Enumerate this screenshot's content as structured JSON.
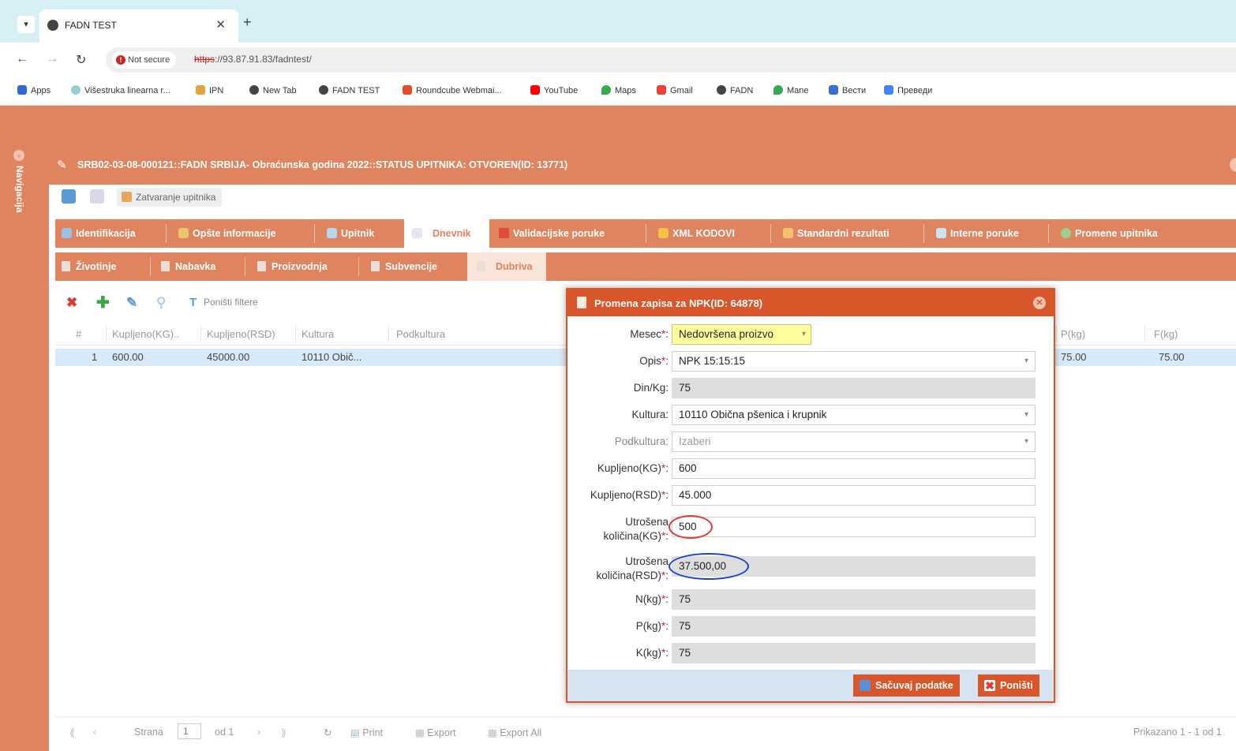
{
  "browser": {
    "tab_title": "FADN TEST",
    "url_scheme": "https",
    "url_rest": "://93.87.91.83/fadntest/",
    "security_label": "Not secure",
    "bookmarks": [
      "Apps",
      "Višestruka linearna r...",
      "IPN",
      "New Tab",
      "FADN TEST",
      "Roundcube Webmai...",
      "YouTube",
      "Maps",
      "Gmail",
      "FADN",
      "Mane",
      "Вести",
      "Преведи"
    ]
  },
  "nav": {
    "label": "Navigacija"
  },
  "panel": {
    "title": "SRB02-03-08-000121::FADN SRBIJA- Obraćunska godina 2022::STATUS UPITNIKA: OTVOREN(ID: 13771)",
    "toolbar_close_label": "Zatvaranje upitnika"
  },
  "main_tabs": [
    "Identifikacija",
    "Opšte informacije",
    "Upitnik",
    "Dnevnik",
    "Validacijske poruke",
    "XML KODOVI",
    "Standardni rezultati",
    "Interne poruke",
    "Promene upitnika"
  ],
  "sub_tabs": [
    "Životinje",
    "Nabavka",
    "Proizvodnja",
    "Subvencije",
    "Dubriva"
  ],
  "grid": {
    "reset_filters_label": "Poništi filtere",
    "headers": [
      "#",
      "Kupljeno(KG)..",
      "Kupljeno(RSD)",
      "Kultura",
      "Podkultura",
      "P(kg)",
      "F(kg)"
    ],
    "row": {
      "num": "1",
      "kg": "600.00",
      "rsd": "45000.00",
      "kultura": "10110 Obič...",
      "p": "75.00",
      "f": "75.00"
    }
  },
  "pager": {
    "page_label": "Strana",
    "page_value": "1",
    "of_label": "od 1",
    "print": "Print",
    "export": "Export",
    "export_all": "Export All",
    "summary": "Prikazano 1 - 1 od 1"
  },
  "dialog": {
    "title": "Promena zapisa za NPK(ID: 64878)",
    "fields": {
      "mesec": {
        "label": "Mesec",
        "value": "Nedovršena proizvo"
      },
      "opis": {
        "label": "Opis",
        "value": "NPK 15:15:15"
      },
      "dinkg": {
        "label": "Din/Kg:",
        "value": "75"
      },
      "kultura": {
        "label": "Kultura:",
        "value": "10110 Obična pšenica i krupnik"
      },
      "podkultura": {
        "label": "Podkultura:",
        "value": "Izaberi"
      },
      "kupljeno_kg": {
        "label": "Kupljeno(KG)",
        "value": "600"
      },
      "kupljeno_rsd": {
        "label": "Kupljeno(RSD)",
        "value": "45.000"
      },
      "utrosena_kg": {
        "label_1": "Utrošena",
        "label_2": "količina(KG)",
        "value": "500"
      },
      "utrosena_rsd": {
        "label_1": "Utrošena",
        "label_2": "količina(RSD)",
        "value": "37.500,00"
      },
      "n": {
        "label": "N(kg)",
        "value": "75"
      },
      "p": {
        "label": "P(kg)",
        "value": "75"
      },
      "k": {
        "label": "K(kg)",
        "value": "75"
      }
    },
    "required_marker": "*",
    "colon": ":",
    "save_label": "Sačuvaj podatke",
    "cancel_label": "Poništi"
  },
  "colors": {
    "accent": "#e0845f",
    "dialog_accent": "#d9562a",
    "highlight_red": "#e53935",
    "highlight_blue": "#1e3fd0"
  }
}
